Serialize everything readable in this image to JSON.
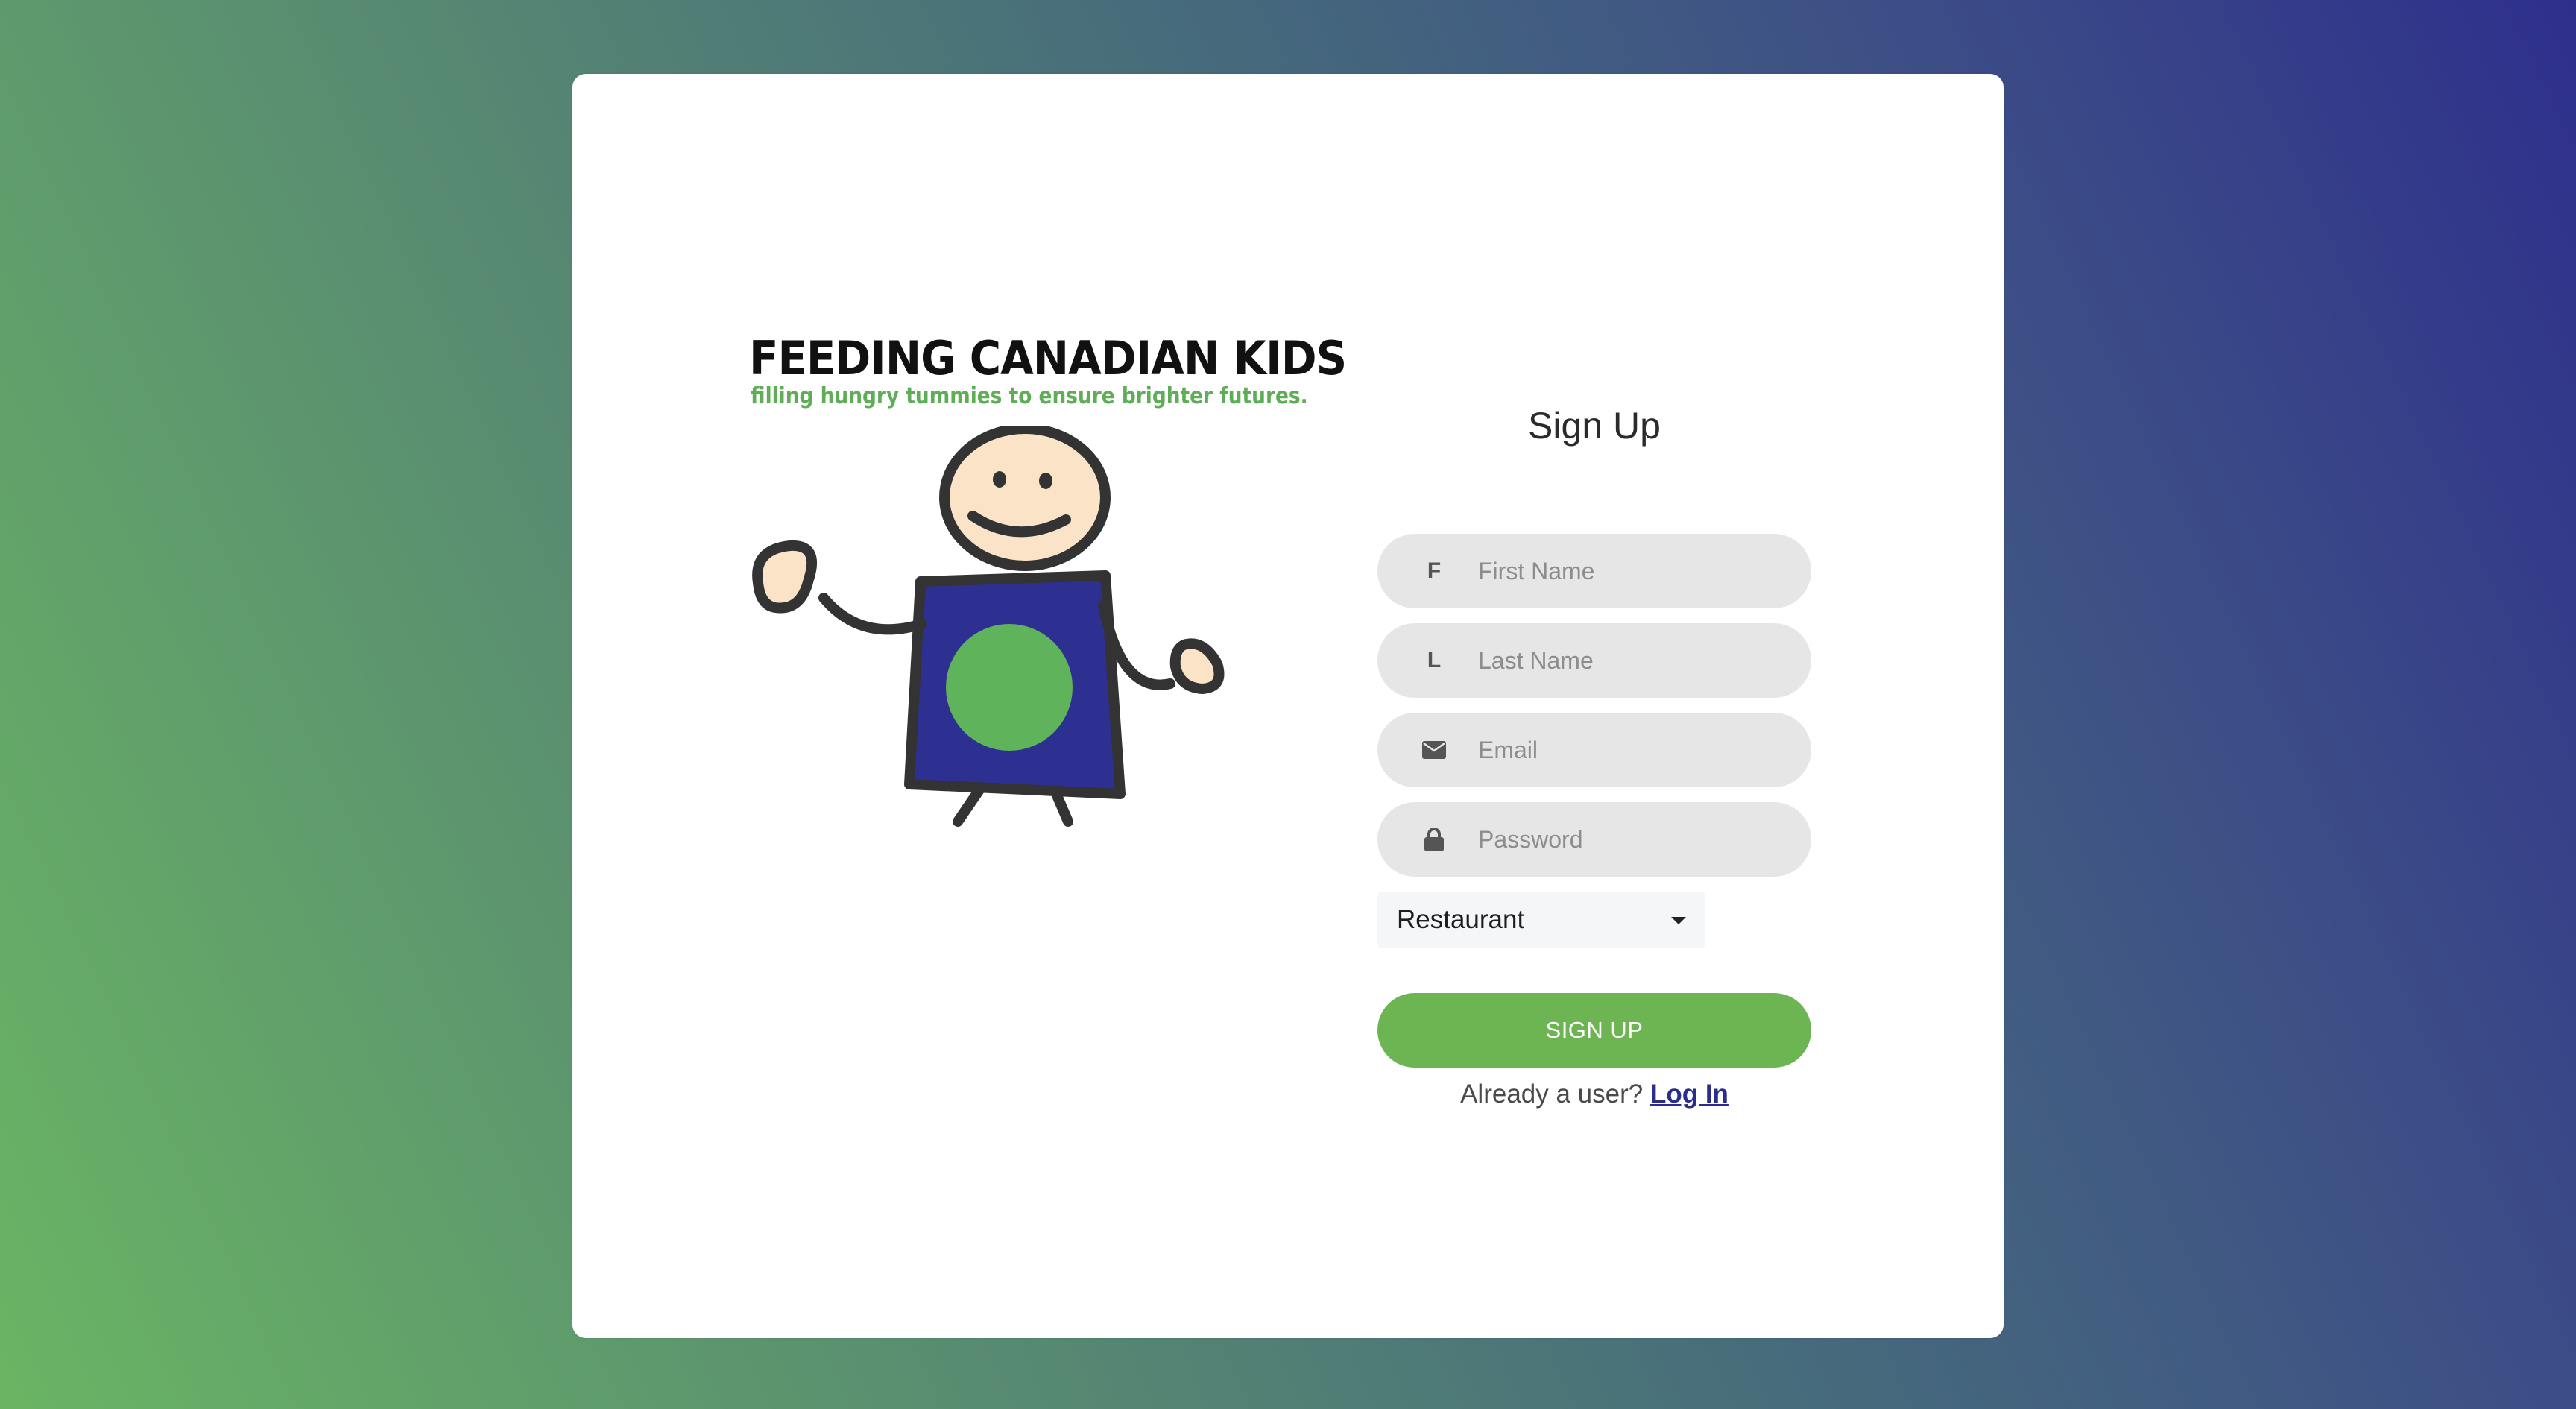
{
  "brand": {
    "name": "FEEDING CANADIAN KIDS",
    "tagline": "filling hungry tummies to ensure brighter futures.",
    "colors": {
      "green": "#6db553",
      "navy": "#2b2d8a",
      "skin": "#fbe3c8",
      "outline": "#333333"
    }
  },
  "form": {
    "title": "Sign Up",
    "fields": [
      {
        "icon": "F",
        "icon_name": "letter-f-icon",
        "placeholder": "First Name",
        "value": ""
      },
      {
        "icon": "L",
        "icon_name": "letter-l-icon",
        "placeholder": "Last Name",
        "value": ""
      },
      {
        "icon": "envelope",
        "icon_name": "envelope-icon",
        "placeholder": "Email",
        "value": ""
      },
      {
        "icon": "lock",
        "icon_name": "lock-icon",
        "placeholder": "Password",
        "value": ""
      }
    ],
    "user_type": {
      "selected": "Restaurant"
    },
    "submit_label": "SIGN UP",
    "login_prompt": "Already a user?",
    "login_link": "Log In"
  }
}
